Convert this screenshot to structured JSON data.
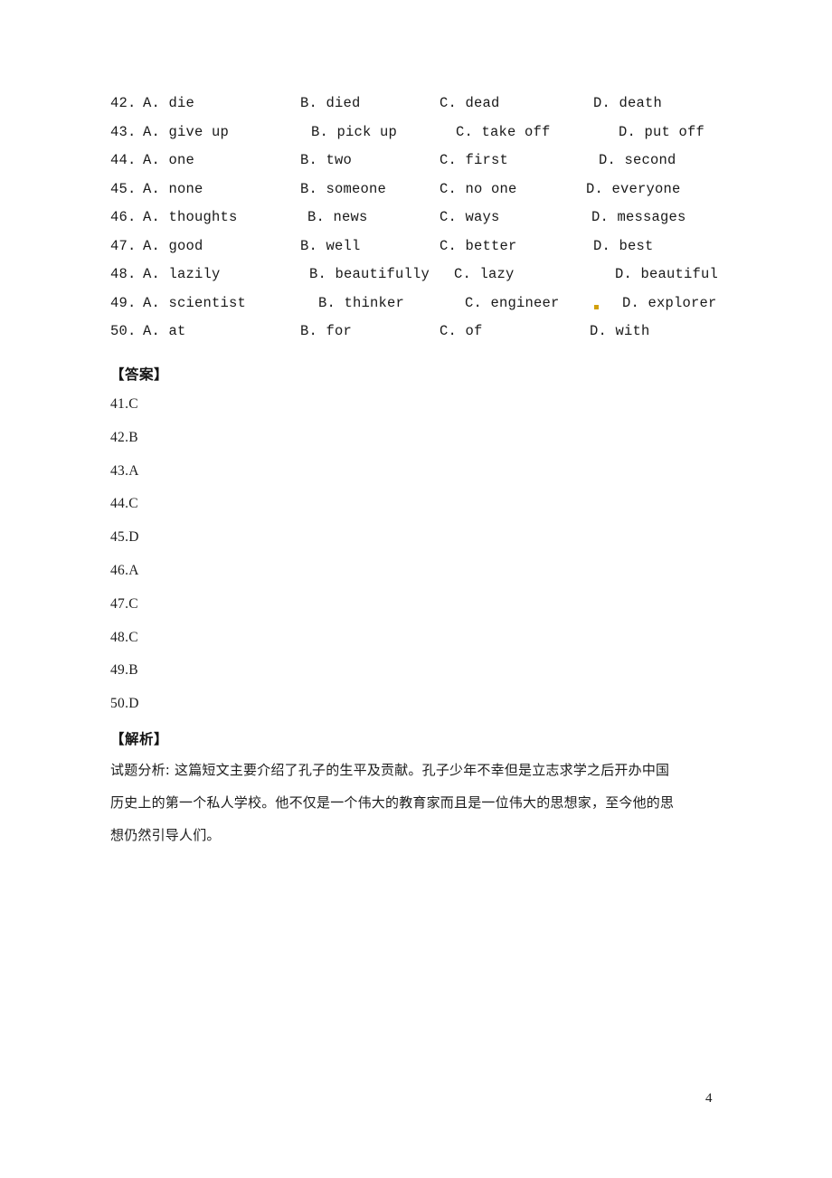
{
  "document": {
    "page_number": "4",
    "artifact_color": "#d2a00c"
  },
  "questions": {
    "rows": [
      {
        "number": "42.",
        "a": "A. die",
        "b": "B. died",
        "c": "C. dead",
        "d": "D. death"
      },
      {
        "number": "43.",
        "a": "A. give up",
        "b": "B. pick up",
        "c": "C. take off",
        "d": "D. put off"
      },
      {
        "number": "44.",
        "a": "A. one",
        "b": "B. two",
        "c": "C. first",
        "d": "D. second"
      },
      {
        "number": "45.",
        "a": "A. none",
        "b": "B. someone",
        "c": "C. no one",
        "d": "D. everyone"
      },
      {
        "number": "46.",
        "a": "A. thoughts",
        "b": "B. news",
        "c": "C. ways",
        "d": "D. messages"
      },
      {
        "number": "47.",
        "a": "A. good",
        "b": "B. well",
        "c": "C. better",
        "d": "D. best"
      },
      {
        "number": "48.",
        "a": "A. lazily",
        "b": "B. beautifully",
        "c": "C. lazy",
        "d": "D. beautiful"
      },
      {
        "number": "49.",
        "a": "A. scientist",
        "b": "B. thinker",
        "c": "C. engineer",
        "d": "D. explorer"
      },
      {
        "number": "50.",
        "a": "A. at",
        "b": "B. for",
        "c": "C. of",
        "d": "D. with"
      }
    ]
  },
  "answers": {
    "heading": "【答案】",
    "items": [
      "41.C",
      "42.B",
      "43.A",
      "44.C",
      "45.D",
      "46.A",
      "47.C",
      "48.C",
      "49.B",
      "50.D"
    ]
  },
  "analysis": {
    "heading": "【解析】",
    "lines": [
      "试题分析: 这篇短文主要介绍了孔子的生平及贡献。孔子少年不幸但是立志求学之后开办中国",
      "历史上的第一个私人学校。他不仅是一个伟大的教育家而且是一位伟大的思想家，至今他的思",
      "想仍然引导人们。"
    ]
  }
}
